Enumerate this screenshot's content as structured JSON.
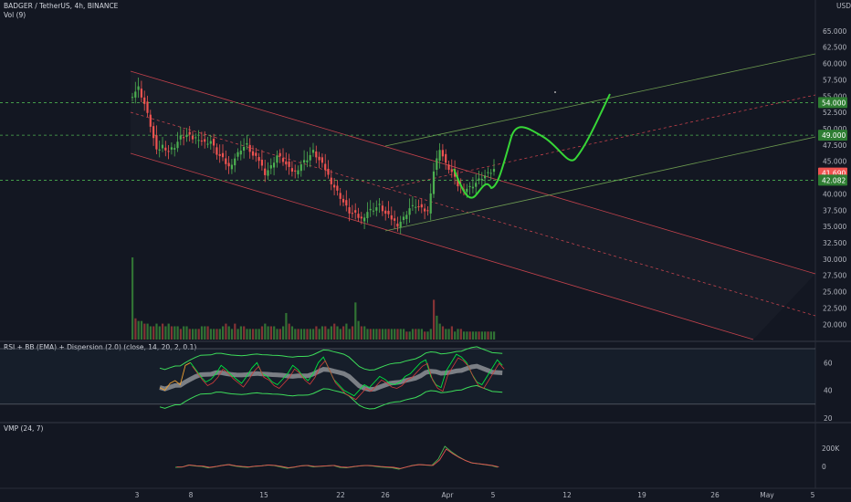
{
  "header": {
    "symbol": "BADGER / TetherUS, 4h, BINANCE",
    "volume_label": "Vol (9)",
    "currency": "USDT"
  },
  "indicators": {
    "rsi_label": "RSI + BB (EMA) + Dispersion (2.0) (close, 14, 20, 2, 0.1)",
    "vmp_label": "VMP (24, 7)"
  },
  "colors": {
    "background": "#131722",
    "up": "#26a69a",
    "up_green": "#4caf50",
    "down": "#ef5350",
    "channel_red": "#c2404a",
    "channel_green": "#6c9a4f",
    "projection": "#37d637",
    "rsi_line": "#00e640",
    "price_tag_red": "#ef5350",
    "price_tag_green": "#2e7d32"
  },
  "chart_data": [
    {
      "type": "candlestick",
      "title": "BADGER / TetherUS, 4h, BINANCE",
      "yunit": "USDT",
      "ylim": [
        18.5,
        67.5
      ],
      "y_ticks": [
        "65.000",
        "62.500",
        "60.000",
        "57.500",
        "55.000",
        "52.500",
        "50.000",
        "47.500",
        "45.000",
        "42.500",
        "40.000",
        "37.500",
        "35.000",
        "32.500",
        "30.000",
        "27.500",
        "25.000",
        "22.500",
        "20.000"
      ],
      "x_ticks": [
        "3",
        "8",
        "15",
        "22",
        "26",
        "Apr",
        "5",
        "12",
        "19",
        "26",
        "May",
        "5"
      ],
      "price_labels": [
        {
          "text": "54.000",
          "value": 54.0,
          "style": "green"
        },
        {
          "text": "49.000",
          "value": 49.0,
          "style": "green"
        },
        {
          "text": "41.690",
          "value": 43.2,
          "style": "red"
        },
        {
          "text": "42.082",
          "value": 42.1,
          "style": "green"
        }
      ],
      "horizontal_levels": [
        54.0,
        49.0,
        42.1
      ],
      "close_path": [
        [
          0,
          55.2
        ],
        [
          2,
          56.3
        ],
        [
          4,
          53.8
        ],
        [
          6,
          50.5
        ],
        [
          8,
          46.5
        ],
        [
          10,
          47.4
        ],
        [
          12,
          46.6
        ],
        [
          14,
          47.3
        ],
        [
          16,
          48.7
        ],
        [
          18,
          49.0
        ],
        [
          20,
          48.5
        ],
        [
          22,
          48.6
        ],
        [
          24,
          47.8
        ],
        [
          26,
          48.1
        ],
        [
          28,
          46.2
        ],
        [
          30,
          45.3
        ],
        [
          32,
          44.1
        ],
        [
          34,
          45.5
        ],
        [
          36,
          46.9
        ],
        [
          38,
          47.5
        ],
        [
          40,
          45.8
        ],
        [
          42,
          45.2
        ],
        [
          44,
          43.2
        ],
        [
          46,
          44.2
        ],
        [
          48,
          45.9
        ],
        [
          50,
          45.1
        ],
        [
          52,
          43.8
        ],
        [
          54,
          43.3
        ],
        [
          56,
          44.6
        ],
        [
          58,
          45.4
        ],
        [
          60,
          46.5
        ],
        [
          62,
          45.1
        ],
        [
          64,
          43.8
        ],
        [
          66,
          41.8
        ],
        [
          68,
          40.3
        ],
        [
          70,
          38.7
        ],
        [
          72,
          37.2
        ],
        [
          74,
          36.8
        ],
        [
          76,
          36.1
        ],
        [
          78,
          37.3
        ],
        [
          80,
          37.7
        ],
        [
          82,
          38.2
        ],
        [
          84,
          36.9
        ],
        [
          86,
          36.2
        ],
        [
          88,
          35.3
        ],
        [
          90,
          36.3
        ],
        [
          92,
          37.8
        ],
        [
          94,
          38.2
        ],
        [
          96,
          37.6
        ],
        [
          98,
          37.3
        ],
        [
          100,
          43.5
        ],
        [
          102,
          47.0
        ],
        [
          104,
          44.5
        ],
        [
          106,
          43.3
        ],
        [
          108,
          41.3
        ],
        [
          110,
          40.7
        ],
        [
          112,
          41.0
        ],
        [
          114,
          41.7
        ],
        [
          116,
          42.5
        ],
        [
          118,
          43.0
        ],
        [
          120,
          43.7
        ]
      ],
      "volume": [
        31,
        8,
        7,
        7,
        6,
        6,
        5,
        5,
        6,
        5,
        6,
        5,
        6,
        5,
        5,
        5,
        4,
        5,
        5,
        4,
        4,
        4,
        4,
        5,
        5,
        5,
        4,
        4,
        4,
        4,
        5,
        6,
        5,
        4,
        6,
        4,
        5,
        5,
        4,
        4,
        4,
        4,
        4,
        5,
        6,
        5,
        5,
        5,
        4,
        4,
        5,
        10,
        6,
        5,
        4,
        4,
        4,
        4,
        4,
        4,
        4,
        5,
        4,
        5,
        5,
        4,
        5,
        6,
        5,
        4,
        5,
        6,
        4,
        5,
        14,
        7,
        5,
        5,
        4,
        4,
        4,
        4,
        4,
        4,
        4,
        4,
        4,
        4,
        4,
        4,
        4,
        3,
        3,
        4,
        4,
        4,
        4,
        3,
        3,
        4,
        15,
        9,
        6,
        5,
        4,
        4,
        5,
        3,
        4,
        4,
        3,
        3,
        3,
        3,
        3,
        3,
        3,
        3,
        3,
        3,
        3
      ]
    },
    {
      "type": "line",
      "title": "RSI + BB (EMA) + Dispersion (2.0) (close, 14, 20, 2, 0.1)",
      "y_ticks": [
        "60",
        "40",
        "20"
      ],
      "ylim": [
        18,
        74
      ],
      "levels": [
        70,
        30
      ],
      "series": [
        {
          "name": "RSI",
          "values": [
            42,
            40,
            45,
            47,
            44,
            58,
            60,
            55,
            50,
            46,
            48,
            52,
            58,
            55,
            51,
            48,
            45,
            50,
            56,
            60,
            52,
            50,
            46,
            44,
            48,
            52,
            58,
            55,
            50,
            47,
            52,
            60,
            64,
            56,
            48,
            44,
            40,
            38,
            36,
            40,
            44,
            42,
            46,
            50,
            48,
            45,
            44,
            46,
            50,
            52,
            56,
            60,
            62,
            50,
            44,
            42,
            54,
            60,
            66,
            64,
            60,
            52,
            46,
            44,
            50,
            56,
            62,
            58
          ]
        }
      ]
    },
    {
      "type": "line",
      "title": "VMP (24, 7)",
      "y_ticks": [
        "200K",
        "0"
      ],
      "series": [
        {
          "name": "VMP",
          "values": [
            -10,
            -8,
            15,
            5,
            0,
            -15,
            -5,
            10,
            20,
            5,
            -5,
            -10,
            0,
            5,
            15,
            10,
            -5,
            -20,
            -10,
            5,
            10,
            -5,
            0,
            5,
            10,
            -10,
            -15,
            -5,
            5,
            10,
            5,
            -5,
            -10,
            -15,
            -30,
            -10,
            10,
            20,
            15,
            10,
            80,
            220,
            160,
            110,
            70,
            40,
            30,
            20,
            10,
            -10
          ]
        }
      ]
    }
  ]
}
